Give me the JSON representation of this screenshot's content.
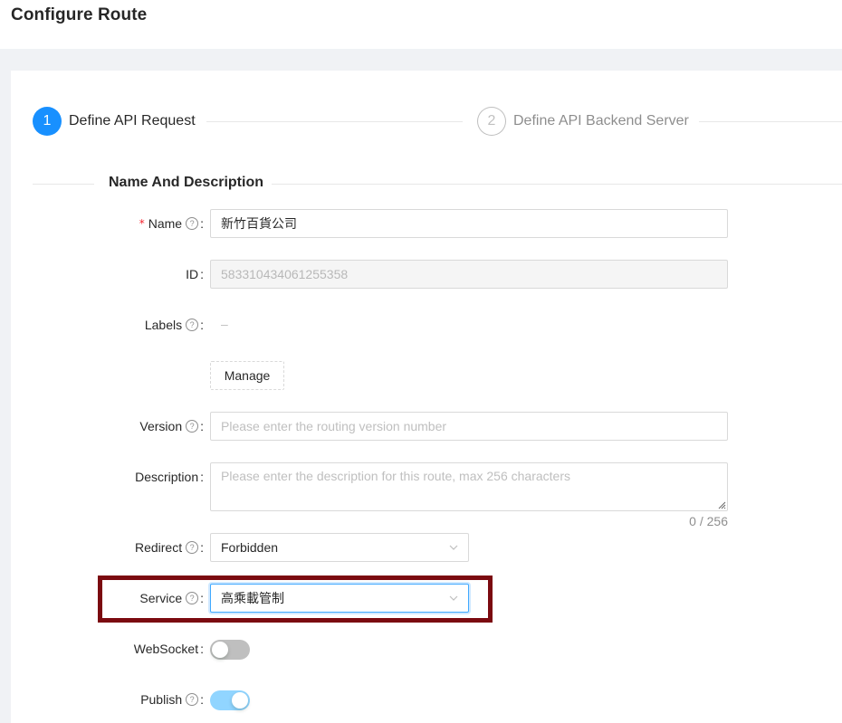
{
  "page": {
    "title": "Configure Route"
  },
  "steps": [
    {
      "number": "1",
      "title": "Define API Request",
      "status": "active"
    },
    {
      "number": "2",
      "title": "Define API Backend Server",
      "status": "wait"
    }
  ],
  "section": {
    "title": "Name And Description"
  },
  "form": {
    "name": {
      "label": "Name",
      "required_mark": "*",
      "value": "新竹百貨公司"
    },
    "id": {
      "label": "ID",
      "value": "583310434061255358"
    },
    "labels": {
      "label": "Labels",
      "empty_text": "–",
      "manage_button": "Manage"
    },
    "version": {
      "label": "Version",
      "placeholder": "Please enter the routing version number"
    },
    "description": {
      "label": "Description",
      "placeholder": "Please enter the description for this route, max 256 characters",
      "count": "0 / 256"
    },
    "redirect": {
      "label": "Redirect",
      "value": "Forbidden"
    },
    "service": {
      "label": "Service",
      "value": "高乘載管制"
    },
    "websocket": {
      "label": "WebSocket",
      "enabled": false
    },
    "publish": {
      "label": "Publish",
      "enabled": true
    }
  },
  "icons": {
    "help": "question-circle-icon",
    "select_arrow": "chevron-down-icon"
  },
  "colors": {
    "primary": "#1890ff",
    "highlight_border": "#7b0a10",
    "required": "#f5222d"
  }
}
